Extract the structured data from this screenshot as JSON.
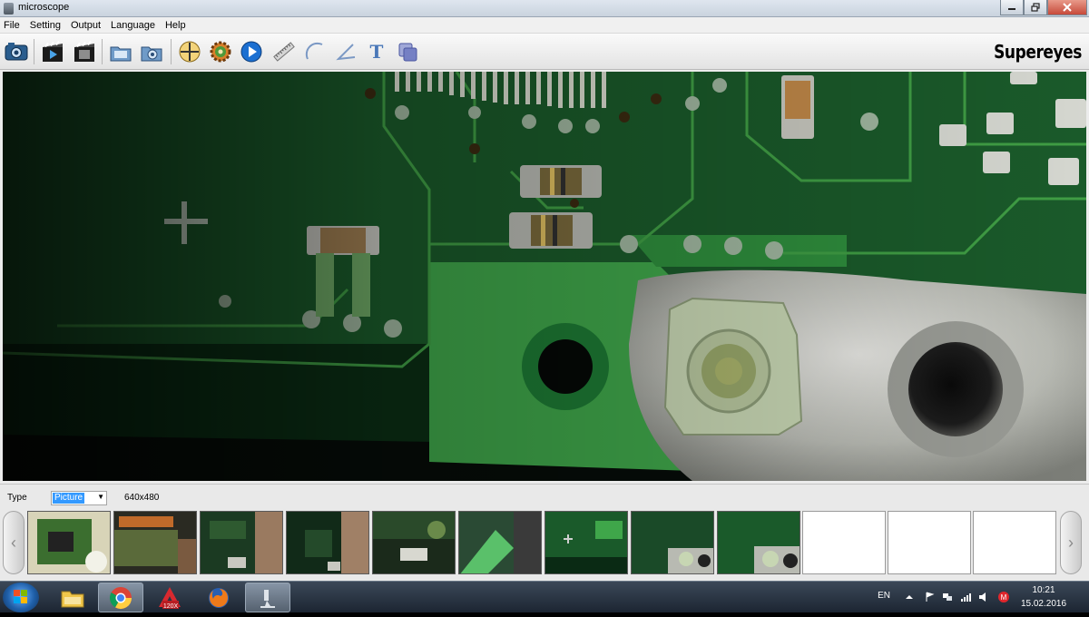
{
  "window": {
    "title": "microscope"
  },
  "menu": [
    "File",
    "Setting",
    "Output",
    "Language",
    "Help"
  ],
  "toolbar": {
    "icons": [
      "camera-icon",
      "record-video-icon",
      "video-stop-icon",
      "open-folder-icon",
      "settings-folder-icon",
      "crosshair-icon",
      "gear-icon",
      "play-icon",
      "ruler-icon",
      "arc-icon",
      "angle-icon",
      "text-icon",
      "layers-icon"
    ],
    "text_tool": "T",
    "logo": "Supereyes"
  },
  "bottom": {
    "type_label": "Type",
    "type_value": "Picture",
    "resolution": "640x480",
    "thumbnails_filled": 9,
    "thumbnails_empty": 3
  },
  "taskbar": {
    "apps": [
      "windows-explorer",
      "chrome",
      "autocad",
      "firefox",
      "microscope"
    ],
    "language": "EN",
    "time": "10:21",
    "date": "15.02.2016"
  },
  "colors": {
    "pcb_green": "#2f9a3c",
    "titlebar": "#c9d3de",
    "taskbar": "#2a3645",
    "selection": "#3399ff"
  }
}
